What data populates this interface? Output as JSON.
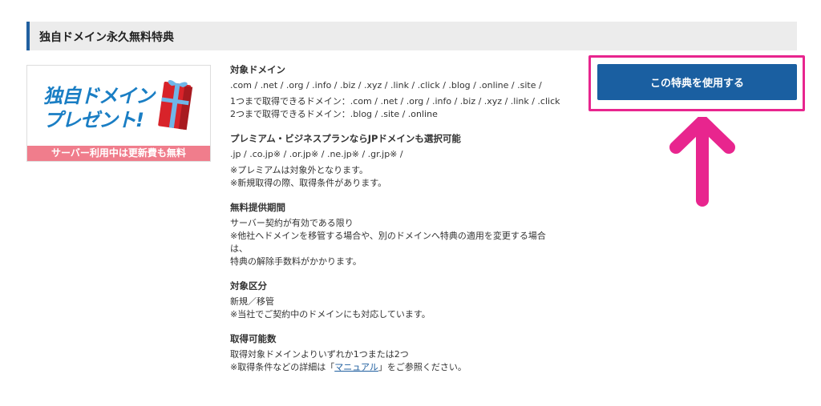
{
  "section": {
    "title": "独自ドメイン永久無料特典"
  },
  "banner": {
    "line1": "独自ドメイン",
    "line2": "プレゼント!",
    "strip": "サーバー利用中は更新費も無料"
  },
  "blocks": [
    {
      "heading": "対象ドメイン",
      "paragraphs": [
        [
          ".com / .net / .org / .info / .biz / .xyz / .link / .click / .blog / .online / .site /"
        ],
        [
          "1つまで取得できるドメイン：.com / .net / .org / .info / .biz / .xyz / .link / .click",
          "2つまで取得できるドメイン：.blog / .site / .online"
        ]
      ]
    },
    {
      "heading": "プレミアム・ビジネスプランならJPドメインも選択可能",
      "paragraphs": [
        [
          ".jp / .co.jp※ / .or.jp※ / .ne.jp※ / .gr.jp※ /"
        ],
        [
          "※プレミアムは対象外となります。",
          "※新規取得の際、取得条件があります。"
        ]
      ]
    },
    {
      "heading": "無料提供期間",
      "paragraphs": [
        [
          "サーバー契約が有効である限り",
          "※他社へドメインを移管する場合や、別のドメインへ特典の適用を変更する場合",
          "は、",
          "特典の解除手数料がかかります。"
        ]
      ]
    },
    {
      "heading": "対象区分",
      "paragraphs": [
        [
          "新規／移管",
          "※当社でご契約中のドメインにも対応しています。"
        ]
      ]
    },
    {
      "heading": "取得可能数",
      "paragraphs": [
        [
          "取得対象ドメインよりいずれか1つまたは2つ"
        ]
      ]
    }
  ],
  "manual_line": {
    "prefix": "※取得条件などの詳細は「",
    "link": "マニュアル",
    "suffix": "」をご参照ください。"
  },
  "cta": {
    "label": "この特典を使用する"
  },
  "colors": {
    "accent": "#1a5fa1",
    "highlight": "#e8258e",
    "banner_strip": "#f07d8c"
  }
}
